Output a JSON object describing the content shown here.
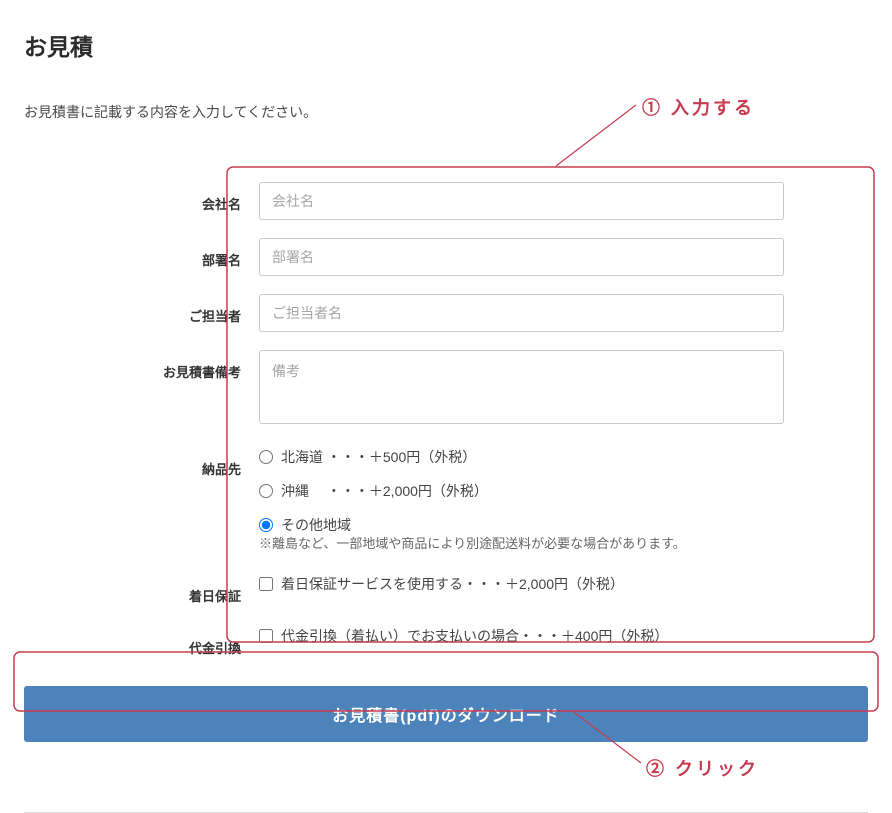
{
  "page": {
    "title": "お見積",
    "instruction": "お見積書に記載する内容を入力してください。"
  },
  "annotations": {
    "step1": "① 入力する",
    "step2": "② クリック"
  },
  "form": {
    "company": {
      "label": "会社名",
      "placeholder": "会社名"
    },
    "department": {
      "label": "部署名",
      "placeholder": "部署名"
    },
    "contact": {
      "label": "ご担当者",
      "placeholder": "ご担当者名"
    },
    "remarks": {
      "label": "お見積書備考",
      "placeholder": "備考"
    },
    "delivery": {
      "label": "納品先",
      "options": [
        "北海道 ・・・＋500円（外税）",
        "沖縄　 ・・・＋2,000円（外税）",
        "その他地域"
      ],
      "note": "※離島など、一部地域や商品により別途配送料が必要な場合があります。",
      "selected_index": 2
    },
    "arrival_guarantee": {
      "label": "着日保証",
      "text": "着日保証サービスを使用する・・・＋2,000円（外税）"
    },
    "cod": {
      "label": "代金引換",
      "text": "代金引換（着払い）でお支払いの場合・・・＋400円（外税）"
    }
  },
  "button": {
    "download_label": "お見積書(pdf)のダウンロード"
  }
}
